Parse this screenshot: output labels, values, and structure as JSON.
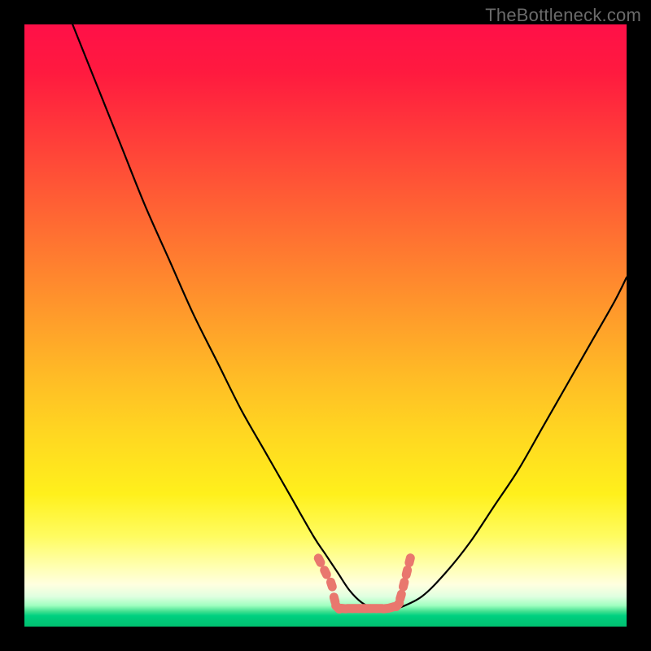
{
  "watermark": "TheBottleneck.com",
  "colors": {
    "curve_stroke": "#000000",
    "marker_fill": "#e9776e",
    "marker_stroke": "#e9776e",
    "background": "#000000"
  },
  "chart_data": {
    "type": "line",
    "title": "",
    "xlabel": "",
    "ylabel": "",
    "xlim": [
      0,
      100
    ],
    "ylim": [
      0,
      100
    ],
    "series": [
      {
        "name": "bottleneck-curve",
        "x": [
          8,
          12,
          16,
          20,
          24,
          28,
          32,
          36,
          40,
          44,
          48,
          50,
          52,
          54,
          56,
          58,
          60,
          62,
          66,
          70,
          74,
          78,
          82,
          86,
          90,
          94,
          98,
          100
        ],
        "y": [
          100,
          90,
          80,
          70,
          61,
          52,
          44,
          36,
          29,
          22,
          15,
          12,
          9,
          6,
          4,
          3,
          2.5,
          3,
          5,
          9,
          14,
          20,
          26,
          33,
          40,
          47,
          54,
          58
        ]
      }
    ],
    "markers": {
      "name": "optimal-range",
      "points": [
        {
          "x": 49.0,
          "y": 11.0
        },
        {
          "x": 50.0,
          "y": 9.0
        },
        {
          "x": 51.0,
          "y": 7.0
        },
        {
          "x": 51.5,
          "y": 4.5
        },
        {
          "x": 52.0,
          "y": 3.2
        },
        {
          "x": 53.0,
          "y": 3.0
        },
        {
          "x": 54.0,
          "y": 3.0
        },
        {
          "x": 55.0,
          "y": 3.0
        },
        {
          "x": 56.0,
          "y": 3.0
        },
        {
          "x": 57.0,
          "y": 3.0
        },
        {
          "x": 58.0,
          "y": 3.0
        },
        {
          "x": 59.0,
          "y": 3.0
        },
        {
          "x": 60.0,
          "y": 3.0
        },
        {
          "x": 61.0,
          "y": 3.2
        },
        {
          "x": 62.0,
          "y": 3.6
        },
        {
          "x": 62.5,
          "y": 5.0
        },
        {
          "x": 63.0,
          "y": 7.0
        },
        {
          "x": 63.5,
          "y": 9.0
        },
        {
          "x": 64.0,
          "y": 11.0
        }
      ]
    }
  }
}
